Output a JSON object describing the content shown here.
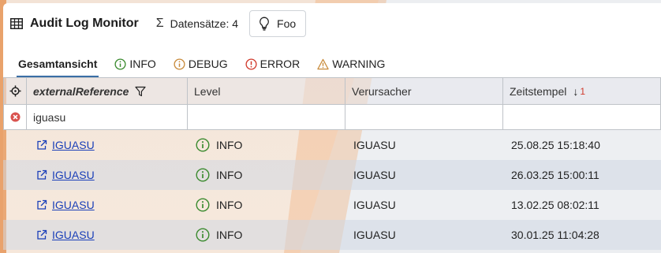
{
  "header": {
    "title": "Audit Log Monitor",
    "record_count_label": "Datensätze: 4",
    "foo_button_label": "Foo"
  },
  "tabs": [
    {
      "label": "Gesamtansicht",
      "active": true
    },
    {
      "label": "INFO",
      "icon": "info-icon",
      "color": "#3a8a2e"
    },
    {
      "label": "DEBUG",
      "icon": "debug-icon",
      "color": "#c88a3a"
    },
    {
      "label": "ERROR",
      "icon": "error-icon",
      "color": "#d0392b"
    },
    {
      "label": "WARNING",
      "icon": "warning-icon",
      "color": "#c88a3a"
    }
  ],
  "grid": {
    "columns": [
      {
        "label": "externalReference"
      },
      {
        "label": "Level"
      },
      {
        "label": "Verursacher"
      },
      {
        "label": "Zeitstempel",
        "sort_order": "1"
      }
    ],
    "filter": {
      "externalReference": "iguasu"
    },
    "rows": [
      {
        "externalReference": "IGUASU",
        "level": "INFO",
        "verursacher": "IGUASU",
        "zeitstempel": "25.08.25 15:18:40"
      },
      {
        "externalReference": "IGUASU",
        "level": "INFO",
        "verursacher": "IGUASU",
        "zeitstempel": "26.03.25 15:00:11"
      },
      {
        "externalReference": "IGUASU",
        "level": "INFO",
        "verursacher": "IGUASU",
        "zeitstempel": "13.02.25 08:02:11"
      },
      {
        "externalReference": "IGUASU",
        "level": "INFO",
        "verursacher": "IGUASU",
        "zeitstempel": "30.01.25 11:04:28"
      }
    ]
  },
  "colors": {
    "accent": "#3a6ea5",
    "link": "#1a3fb8",
    "info": "#3a8a2e",
    "error": "#d0392b"
  }
}
